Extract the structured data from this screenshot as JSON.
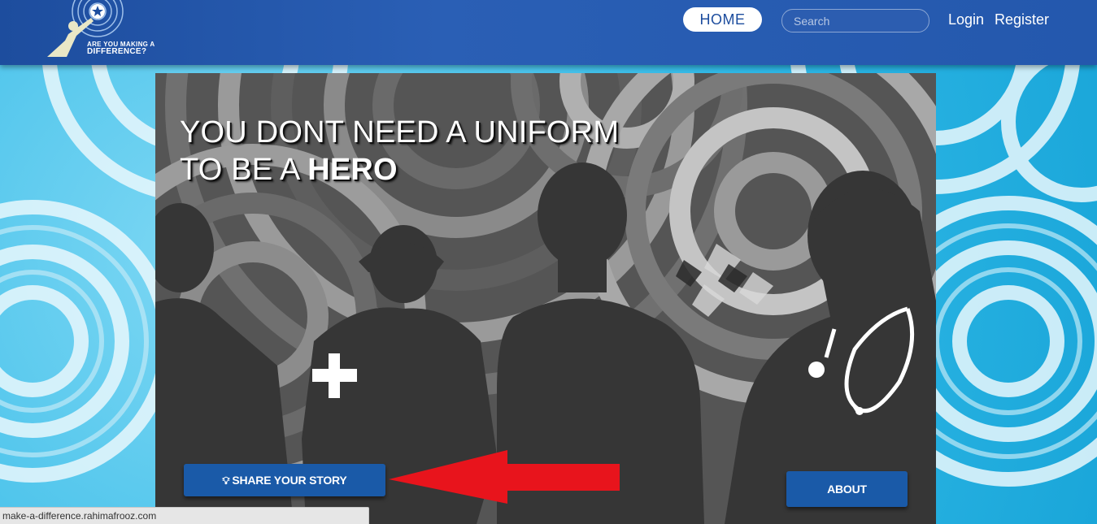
{
  "header": {
    "logo_line1": "ARE YOU MAKING A",
    "logo_line2": "DIFFERENCE?",
    "home_label": "HOME",
    "search_placeholder": "Search",
    "login_label": "Login",
    "register_label": "Register"
  },
  "hero": {
    "title_line1": "YOU DONT NEED A UNIFORM",
    "title_line2_prefix": "TO BE A ",
    "title_line2_bold": "HERO",
    "share_label": "SHARE YOUR STORY",
    "share_icon": "lightbulb-icon",
    "about_label": "ABOUT"
  },
  "status_bar": {
    "url": "make-a-difference.rahimafrooz.com"
  },
  "colors": {
    "header_blue": "#2458ad",
    "button_blue": "#1a5aa8",
    "arrow_red": "#e8141c",
    "background_cyan": "#3fc3ec"
  }
}
